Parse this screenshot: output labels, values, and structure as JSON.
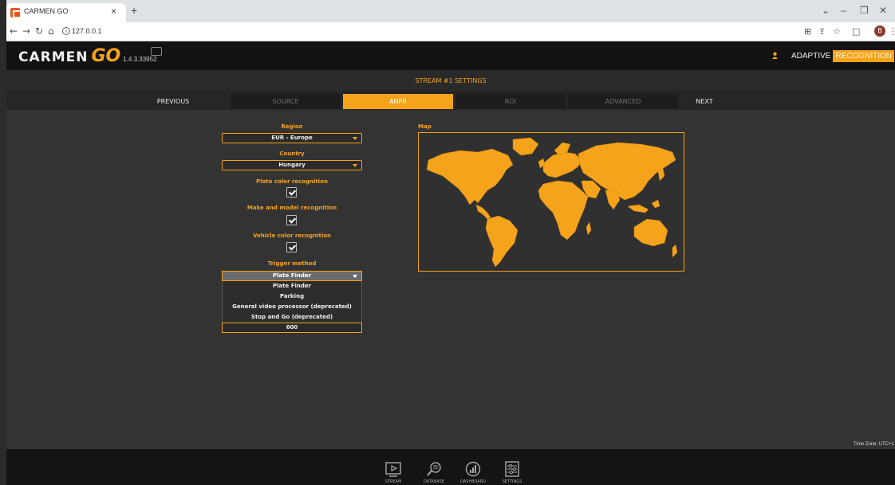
{
  "browser": {
    "tab_title": "CARMEN GO",
    "tab_close": "×",
    "new_tab": "+",
    "url": "127.0.0.1",
    "profile_initial": "B"
  },
  "app": {
    "logo_text": "CARMEN",
    "logo_go": "GO",
    "version": "1.4.3.33952",
    "brand_left": "ADAPTIVE",
    "brand_right": "RECOGNITION"
  },
  "settings": {
    "title": "STREAM #1 SETTINGS",
    "steps": {
      "previous": "PREVIOUS",
      "source": "SOURCE",
      "anpr": "ANPR",
      "roi": "ROI",
      "advanced": "ADVANCED",
      "next": "NEXT"
    },
    "active_step": "ANPR"
  },
  "form": {
    "region_label": "Region",
    "region_value": "EUR - Europe",
    "country_label": "Country",
    "country_value": "Hungary",
    "plate_color_label": "Plate color recognition",
    "plate_color_checked": true,
    "make_model_label": "Make and model recognition",
    "make_model_checked": true,
    "vehicle_color_label": "Vehicle color recognition",
    "vehicle_color_checked": true,
    "trigger_label": "Trigger method",
    "trigger_value": "Plate Finder",
    "trigger_options": [
      "Plate Finder",
      "Parking",
      "General video processor (deprecated)",
      "Stop and Go (deprecated)"
    ],
    "extra_value": "600"
  },
  "map": {
    "label": "Map",
    "land_color": "#f5a31b",
    "ocean_color": "#303030"
  },
  "timezone": "Time Zone: UTC+1",
  "bottom_nav": {
    "stream": "STREAM",
    "database": "DATABASE",
    "dashboard": "DASHBOARD",
    "settings": "SETTINGS"
  },
  "colors": {
    "accent": "#f5a31b",
    "background": "#333333",
    "header": "#121212"
  }
}
